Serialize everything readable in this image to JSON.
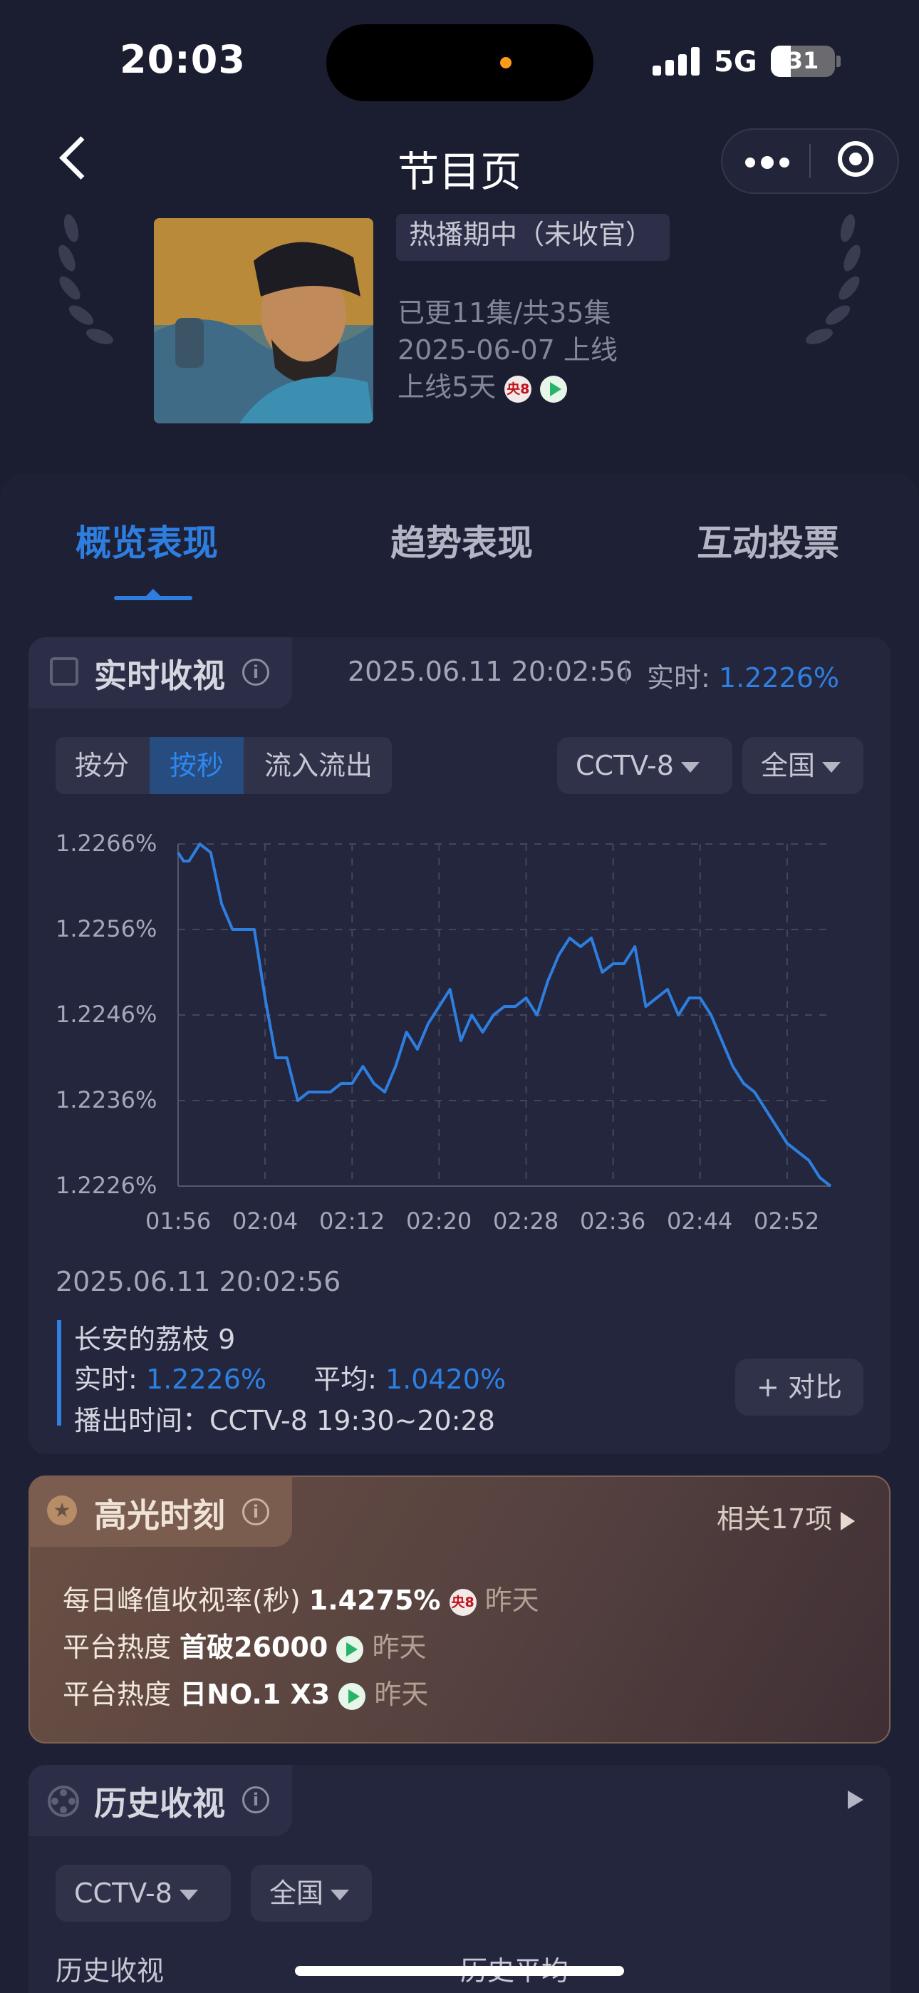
{
  "status_bar": {
    "time": "20:03",
    "network": "5G",
    "battery": "31"
  },
  "nav": {
    "title": "节目页"
  },
  "show": {
    "status_tag": "热播期中（未收官）",
    "episodes": "已更11集/共35集",
    "release": "2025-06-07 上线",
    "days_online": "上线5天",
    "channel_badge": "央8"
  },
  "tabs": [
    {
      "label": "概览表现",
      "active": true
    },
    {
      "label": "趋势表现",
      "active": false
    },
    {
      "label": "互动投票",
      "active": false
    }
  ],
  "realtime": {
    "title": "实时收视",
    "timestamp": "2025.06.11 20:02:56",
    "realtime_label": "实时:",
    "realtime_value": "1.2226%",
    "segments": [
      "按分",
      "按秒",
      "流入流出"
    ],
    "active_segment": "按秒",
    "channel": "CCTV-8",
    "region": "全国",
    "point_time": "2025.06.11 20:02:56",
    "program": "长安的荔枝 9",
    "rt_label": "实时:",
    "rt_value": "1.2226%",
    "avg_label": "平均:",
    "avg_value": "1.0420%",
    "airtime": "播出时间：CCTV-8 19:30~20:28",
    "compare_button": "+ 对比"
  },
  "chart_data": {
    "type": "line",
    "ylim": [
      1.2226,
      1.2266
    ],
    "yticks": [
      "1.2266%",
      "1.2256%",
      "1.2246%",
      "1.2236%",
      "1.2226%"
    ],
    "xticks": [
      "01:56",
      "02:04",
      "02:12",
      "02:20",
      "02:28",
      "02:36",
      "02:44",
      "02:52"
    ],
    "xlim_min": [
      116,
      176
    ],
    "grid": true,
    "color": "#2e7ee0",
    "x": [
      116,
      116.5,
      117,
      118,
      119,
      120,
      121,
      122,
      123,
      124,
      125,
      126,
      127,
      128,
      129,
      130,
      131,
      132,
      133,
      134,
      135,
      136,
      137,
      138,
      139,
      140,
      141,
      142,
      143,
      144,
      145,
      146,
      147,
      148,
      149,
      150,
      151,
      152,
      153,
      154,
      155,
      156,
      157,
      158,
      159,
      160,
      161,
      162,
      163,
      164,
      165,
      166,
      167,
      168,
      169,
      170,
      171,
      172,
      173,
      174,
      175,
      176
    ],
    "y": [
      1.2265,
      1.2264,
      1.2264,
      1.2266,
      1.2265,
      1.2259,
      1.2256,
      1.2256,
      1.2256,
      1.2248,
      1.2241,
      1.2241,
      1.2236,
      1.2237,
      1.2237,
      1.2237,
      1.2238,
      1.2238,
      1.224,
      1.2238,
      1.2237,
      1.224,
      1.2244,
      1.2242,
      1.2245,
      1.2247,
      1.2249,
      1.2243,
      1.2246,
      1.2244,
      1.2246,
      1.2247,
      1.2247,
      1.2248,
      1.2246,
      1.225,
      1.2253,
      1.2255,
      1.2254,
      1.2255,
      1.2251,
      1.2252,
      1.2252,
      1.2254,
      1.2247,
      1.2248,
      1.2249,
      1.2246,
      1.2248,
      1.2248,
      1.2246,
      1.2243,
      1.224,
      1.2238,
      1.2237,
      1.2235,
      1.2233,
      1.2231,
      1.223,
      1.2229,
      1.2227,
      1.2226
    ]
  },
  "highlights": {
    "title": "高光时刻",
    "related": "相关17项",
    "rows": [
      {
        "label": "每日峰值收视率(秒)",
        "value": "1.4275%",
        "badge": "央8",
        "when": "昨天"
      },
      {
        "label": "平台热度",
        "value": "首破26000",
        "when": "昨天"
      },
      {
        "label": "平台热度",
        "value": "日NO.1 X3",
        "when": "昨天"
      }
    ]
  },
  "history": {
    "title": "历史收视",
    "channel": "CCTV-8",
    "region": "全国",
    "col1": "历史收视",
    "col2": "历史平均"
  }
}
